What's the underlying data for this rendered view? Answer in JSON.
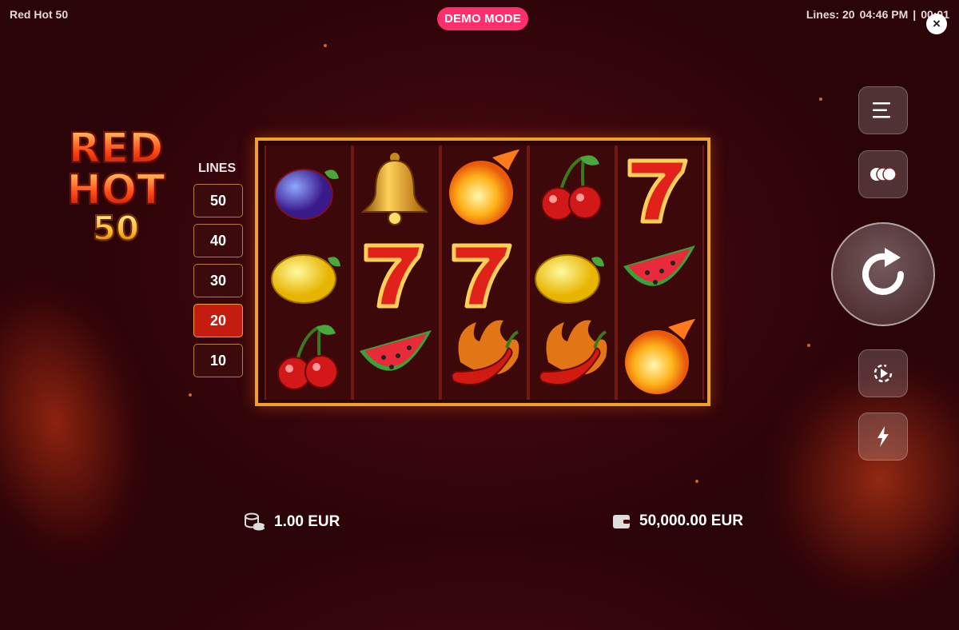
{
  "header": {
    "title": "Red Hot 50",
    "mode_badge": "DEMO MODE",
    "lines_info": "Lines: 20",
    "time": "04:46 PM",
    "separator": "|",
    "timer": "00:01",
    "close_glyph": "×"
  },
  "logo": {
    "line1": "RED",
    "line2": "HOT",
    "line3": "50"
  },
  "lines_panel": {
    "label": "LINES",
    "options": [
      "50",
      "40",
      "30",
      "20",
      "10"
    ],
    "selected": "20"
  },
  "reels": [
    [
      "plum",
      "lemon",
      "cherry"
    ],
    [
      "bell",
      "seven",
      "watermelon"
    ],
    [
      "fireball",
      "seven",
      "chili"
    ],
    [
      "cherry",
      "lemon",
      "chili"
    ],
    [
      "seven",
      "watermelon",
      "fireball"
    ]
  ],
  "side_controls": {
    "menu": "menu-icon",
    "bet_chips": "chips-icon",
    "spin": "spin-icon",
    "autoplay": "autoplay-icon",
    "turbo": "turbo-icon"
  },
  "footer": {
    "bet_value": "1.00 EUR",
    "balance_value": "50,000.00 EUR"
  },
  "colors": {
    "badge": "#ff2f6d",
    "frame": "#f0a12a",
    "active_line": "#c41d10"
  }
}
